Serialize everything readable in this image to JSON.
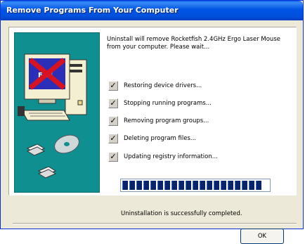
{
  "window": {
    "title": "Remove Programs From Your Computer"
  },
  "message": "Uninstall will remove Rocketfish 2.4GHz Ergo Laser Mouse from your computer.  Please wait...",
  "tasks": [
    {
      "label": "Restoring device drivers...",
      "done": true
    },
    {
      "label": "Stopping running programs...",
      "done": true
    },
    {
      "label": "Removing program groups...",
      "done": true
    },
    {
      "label": "Deleting program files...",
      "done": true
    },
    {
      "label": "Updating registry information...",
      "done": true
    }
  ],
  "check_glyph": "✓",
  "progress": {
    "percent": 100
  },
  "status_text": "Uninstallation is successfully completed.",
  "buttons": {
    "ok": "OK"
  },
  "colors": {
    "titlebar": "#0054e3",
    "side_panel": "#0f8f8f",
    "progress_fill": "#0a246a"
  },
  "icons": {
    "side_illustration": "computer-with-uninstall-x-icon",
    "checkbox": "checkmark-icon"
  }
}
